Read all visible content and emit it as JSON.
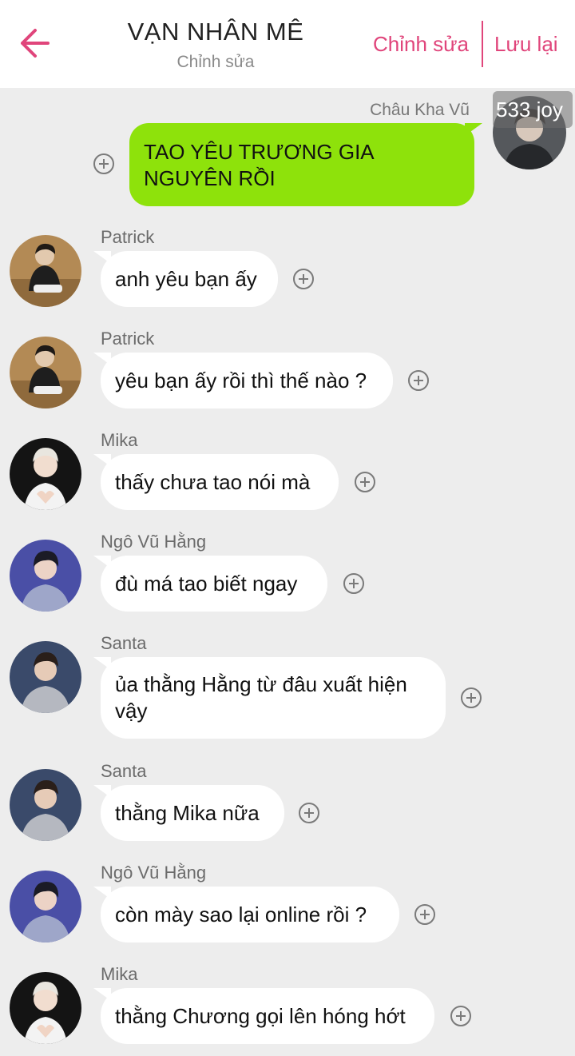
{
  "header": {
    "title": "VẠN NHÂN MÊ",
    "subtitle": "Chỉnh sửa",
    "edit_label": "Chỉnh sửa",
    "save_label": "Lưu lại",
    "back_icon": "arrow-left-icon",
    "accent_color": "#e0457b"
  },
  "outgoing": {
    "sender": "Châu Kha Vũ",
    "text": "TAO YÊU TRƯƠNG GIA NGUYÊN RỒI",
    "overlay": "533 joy",
    "bubble_color": "#8ee20b"
  },
  "messages": [
    {
      "sender": "Patrick",
      "text": "anh yêu bạn ấy"
    },
    {
      "sender": "Patrick",
      "text": "yêu bạn ấy rồi thì thế nào ?"
    },
    {
      "sender": "Mika",
      "text": "thấy chưa tao nói mà"
    },
    {
      "sender": "Ngô Vũ Hằng",
      "text": "đù má tao biết ngay"
    },
    {
      "sender": "Santa",
      "text": "ủa thằng Hằng từ đâu xuất hiện vậy"
    },
    {
      "sender": "Santa",
      "text": "thằng Mika nữa"
    },
    {
      "sender": "Ngô Vũ Hằng",
      "text": "còn mày sao lại online rồi ?"
    },
    {
      "sender": "Mika",
      "text": "thằng Chương gọi lên hóng hớt"
    }
  ],
  "add_icon": "plus-circle-icon"
}
